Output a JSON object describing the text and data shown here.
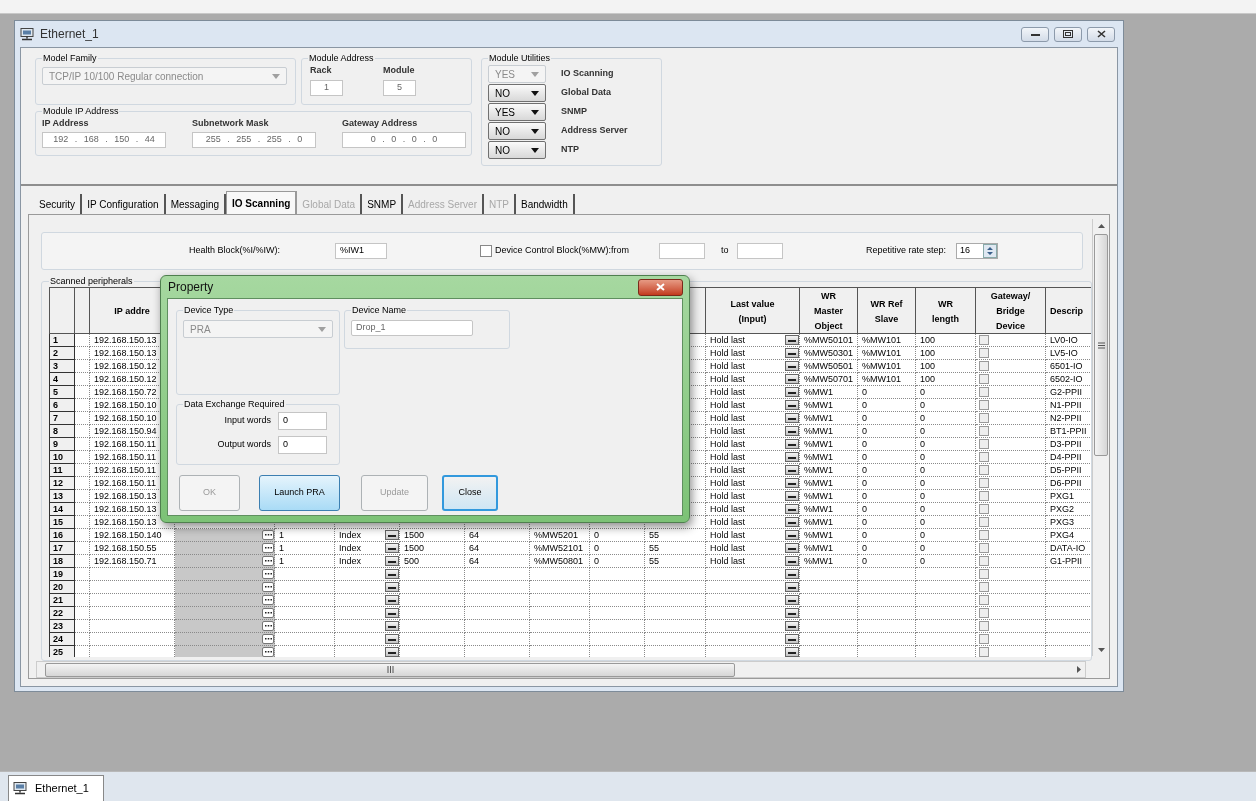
{
  "window": {
    "title": "Ethernet_1"
  },
  "model_family": {
    "label": "Model Family",
    "value": "TCP/IP 10/100 Regular connection",
    "disabled": true
  },
  "module_address": {
    "label": "Module Address",
    "fields": [
      {
        "label": "Rack",
        "value": "1"
      },
      {
        "label": "Module",
        "value": "5"
      }
    ]
  },
  "module_ip": {
    "label": "Module IP Address",
    "fields": [
      {
        "label": "IP Address",
        "value": "192 . 168 . 150 . 44"
      },
      {
        "label": "Subnetwork Mask",
        "value": "255 . 255 . 255 . 0"
      },
      {
        "label": "Gateway Address",
        "value": "0 . 0 . 0 . 0"
      }
    ]
  },
  "module_utilities": {
    "label": "Module Utilities",
    "items": [
      {
        "value": "YES",
        "label": "IO Scanning",
        "disabled": true
      },
      {
        "value": "NO",
        "label": "Global Data",
        "disabled": false
      },
      {
        "value": "YES",
        "label": "SNMP",
        "disabled": false
      },
      {
        "value": "NO",
        "label": "Address Server",
        "disabled": false
      },
      {
        "value": "NO",
        "label": "NTP",
        "disabled": false
      }
    ]
  },
  "tabs": [
    {
      "label": "Security",
      "selected": false,
      "disabled": false
    },
    {
      "label": "IP Configuration",
      "selected": false,
      "disabled": false
    },
    {
      "label": "Messaging",
      "selected": false,
      "disabled": false
    },
    {
      "label": "IO Scanning",
      "selected": true,
      "disabled": false
    },
    {
      "label": "Global Data",
      "selected": false,
      "disabled": true
    },
    {
      "label": "SNMP",
      "selected": false,
      "disabled": false
    },
    {
      "label": "Address Server",
      "selected": false,
      "disabled": true
    },
    {
      "label": "NTP",
      "selected": false,
      "disabled": true
    },
    {
      "label": "Bandwidth",
      "selected": false,
      "disabled": false
    }
  ],
  "options": {
    "health_block": {
      "label": "Health Block(%I/%IW):",
      "value": "%IW1"
    },
    "device_control": {
      "label": "Device Control Block(%MW):from",
      "checked": false,
      "to_label": "to"
    },
    "repetitive": {
      "label": "Repetitive rate step:",
      "value": "16"
    }
  },
  "scanned": {
    "label": "Scanned peripherals",
    "headers": {
      "ip": "IP addre",
      "last_value": "Last value\n(Input)",
      "wr_master": "WR\nMaster\nObject",
      "wr_ref": "WR Ref\nSlave",
      "wr_length": "WR\nlength",
      "gateway": "Gateway/\nBridge\nDevice",
      "description": "Descrip"
    },
    "rows": [
      {
        "number": "1",
        "ip": "192.168.150.13",
        "last_value": "Hold last",
        "wr_master": "%MW50101",
        "wr_ref": "%MW101",
        "wr_length": "100",
        "gateway": false,
        "description": "LV0-IO"
      },
      {
        "number": "2",
        "ip": "192.168.150.13",
        "last_value": "Hold last",
        "wr_master": "%MW50301",
        "wr_ref": "%MW101",
        "wr_length": "100",
        "gateway": false,
        "description": "LV5-IO"
      },
      {
        "number": "3",
        "ip": "192.168.150.12",
        "last_value": "Hold last",
        "wr_master": "%MW50501",
        "wr_ref": "%MW101",
        "wr_length": "100",
        "gateway": false,
        "description": "6501-IO"
      },
      {
        "number": "4",
        "ip": "192.168.150.12",
        "last_value": "Hold last",
        "wr_master": "%MW50701",
        "wr_ref": "%MW101",
        "wr_length": "100",
        "gateway": false,
        "description": "6502-IO"
      },
      {
        "number": "5",
        "ip": "192.168.150.72",
        "last_value": "Hold last",
        "wr_master": "%MW1",
        "wr_ref": "0",
        "wr_length": "0",
        "gateway": false,
        "description": "G2-PPII"
      },
      {
        "number": "6",
        "ip": "192.168.150.10",
        "last_value": "Hold last",
        "wr_master": "%MW1",
        "wr_ref": "0",
        "wr_length": "0",
        "gateway": false,
        "description": "N1-PPII"
      },
      {
        "number": "7",
        "ip": "192.168.150.10",
        "last_value": "Hold last",
        "wr_master": "%MW1",
        "wr_ref": "0",
        "wr_length": "0",
        "gateway": false,
        "description": "N2-PPII"
      },
      {
        "number": "8",
        "ip": "192.168.150.94",
        "last_value": "Hold last",
        "wr_master": "%MW1",
        "wr_ref": "0",
        "wr_length": "0",
        "gateway": false,
        "description": "BT1-PPII"
      },
      {
        "number": "9",
        "ip": "192.168.150.11",
        "last_value": "Hold last",
        "wr_master": "%MW1",
        "wr_ref": "0",
        "wr_length": "0",
        "gateway": false,
        "description": "D3-PPII"
      },
      {
        "number": "10",
        "ip": "192.168.150.11",
        "last_value": "Hold last",
        "wr_master": "%MW1",
        "wr_ref": "0",
        "wr_length": "0",
        "gateway": false,
        "description": "D4-PPII"
      },
      {
        "number": "11",
        "ip": "192.168.150.11",
        "last_value": "Hold last",
        "wr_master": "%MW1",
        "wr_ref": "0",
        "wr_length": "0",
        "gateway": false,
        "description": "D5-PPII"
      },
      {
        "number": "12",
        "ip": "192.168.150.11",
        "last_value": "Hold last",
        "wr_master": "%MW1",
        "wr_ref": "0",
        "wr_length": "0",
        "gateway": false,
        "description": "D6-PPII"
      },
      {
        "number": "13",
        "ip": "192.168.150.13",
        "last_value": "Hold last",
        "wr_master": "%MW1",
        "wr_ref": "0",
        "wr_length": "0",
        "gateway": false,
        "description": "PXG1"
      },
      {
        "number": "14",
        "ip": "192.168.150.13",
        "last_value": "Hold last",
        "wr_master": "%MW1",
        "wr_ref": "0",
        "wr_length": "0",
        "gateway": false,
        "description": "PXG2"
      },
      {
        "number": "15",
        "ip": "192.168.150.13",
        "last_value": "Hold last",
        "wr_master": "%MW1",
        "wr_ref": "0",
        "wr_length": "0",
        "gateway": false,
        "description": "PXG3"
      },
      {
        "number": "16",
        "ip": "192.168.150.140",
        "mid": [
          "1",
          "Index",
          "1500",
          "64",
          "%MW5201",
          "0",
          "55"
        ],
        "last_value": "Hold last",
        "wr_master": "%MW1",
        "wr_ref": "0",
        "wr_length": "0",
        "gateway": false,
        "description": "PXG4"
      },
      {
        "number": "17",
        "ip": "192.168.150.55",
        "mid": [
          "1",
          "Index",
          "1500",
          "64",
          "%MW52101",
          "0",
          "55"
        ],
        "last_value": "Hold last",
        "wr_master": "%MW1",
        "wr_ref": "0",
        "wr_length": "0",
        "gateway": false,
        "description": "DATA-IO"
      },
      {
        "number": "18",
        "ip": "192.168.150.71",
        "mid": [
          "1",
          "Index",
          "500",
          "64",
          "%MW50801",
          "0",
          "55"
        ],
        "last_value": "Hold last",
        "wr_master": "%MW1",
        "wr_ref": "0",
        "wr_length": "0",
        "gateway": false,
        "description": "G1-PPII"
      },
      {
        "number": "19",
        "gateway": false
      },
      {
        "number": "20",
        "gateway": false
      },
      {
        "number": "21",
        "gateway": false
      },
      {
        "number": "22",
        "gateway": false
      },
      {
        "number": "23",
        "gateway": false
      },
      {
        "number": "24",
        "gateway": false
      },
      {
        "number": "25",
        "gateway": false
      }
    ]
  },
  "dialog": {
    "title": "Property",
    "device_type": {
      "label": "Device Type",
      "value": "PRA",
      "disabled": true
    },
    "device_name": {
      "label": "Device Name",
      "value": "Drop_1"
    },
    "data_exchange": {
      "label": "Data Exchange Required",
      "fields": [
        {
          "label": "Input words",
          "value": "0"
        },
        {
          "label": "Output words",
          "value": "0"
        }
      ]
    },
    "buttons": [
      {
        "label": "OK",
        "disabled": true,
        "highlighted": false,
        "focused": false
      },
      {
        "label": "Launch PRA",
        "disabled": false,
        "highlighted": true,
        "focused": false
      },
      {
        "label": "Update",
        "disabled": true,
        "highlighted": false,
        "focused": false
      },
      {
        "label": "Close",
        "disabled": false,
        "highlighted": false,
        "focused": true
      }
    ]
  },
  "taskbar_tab": {
    "label": "Ethernet_1"
  }
}
